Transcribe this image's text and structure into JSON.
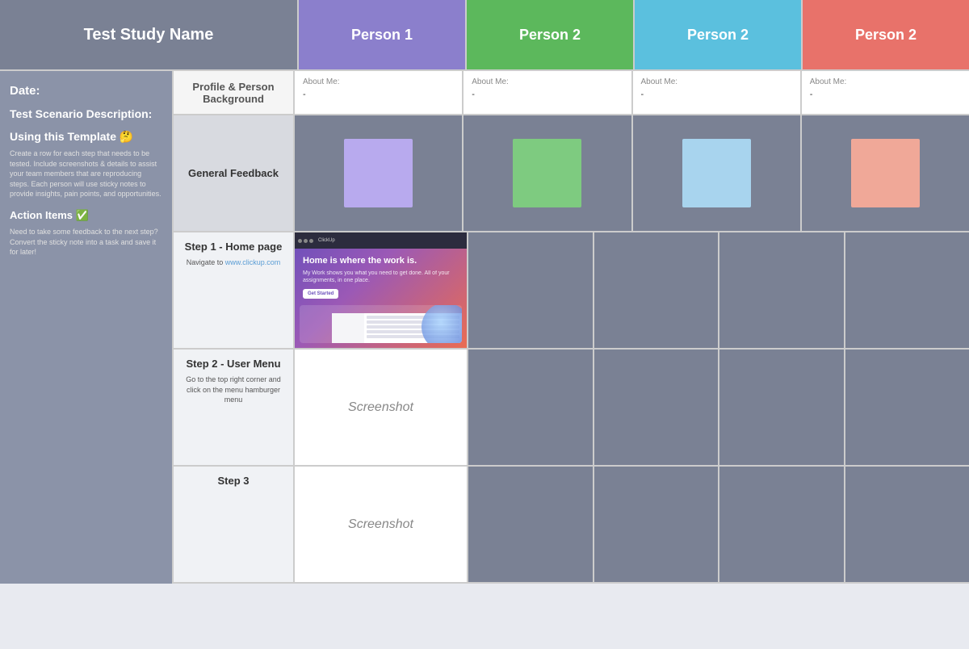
{
  "header": {
    "study_label": "Test Study Name",
    "person1_label": "Person 1",
    "person2a_label": "Person 2",
    "person2b_label": "Person 2",
    "person2c_label": "Person 2"
  },
  "sidebar": {
    "date_label": "Date:",
    "scenario_label": "Test Scenario Description:",
    "template_title": "Using this Template 🤔",
    "template_body": "Create a row for each step that needs to be tested. Include screenshots & details to assist your team members that are reproducing steps. Each person will use sticky notes to provide insights, pain points, and opportunities.",
    "action_title": "Action Items ✅",
    "action_body": "Need to take some feedback to the next step? Convert the sticky note into a task and save it for later!"
  },
  "profile_section": {
    "header": "Profile & Person Background",
    "persons": [
      {
        "label": "About Me:",
        "value": "-"
      },
      {
        "label": "About Me:",
        "value": "-"
      },
      {
        "label": "About Me:",
        "value": "-"
      },
      {
        "label": "About Me:",
        "value": "-"
      }
    ]
  },
  "feedback_section": {
    "header": "General Feedback"
  },
  "steps": [
    {
      "title": "Step 1 - Home page",
      "instruction": "Navigate to ",
      "link_text": "www.clickup.com",
      "has_screenshot_image": true
    },
    {
      "title": "Step 2 - User Menu",
      "instruction": "Go to the top right corner and click on the menu hamburger menu",
      "has_screenshot_image": false,
      "screenshot_label": "Screenshot"
    },
    {
      "title": "Step 3",
      "instruction": "",
      "has_screenshot_image": false,
      "screenshot_label": "Screenshot"
    }
  ],
  "clickup": {
    "hero_title": "Home is where the work is.",
    "hero_body": "My Work shows you what you need to get done. All of your assignments, in one place.",
    "cta": "Get Started"
  }
}
